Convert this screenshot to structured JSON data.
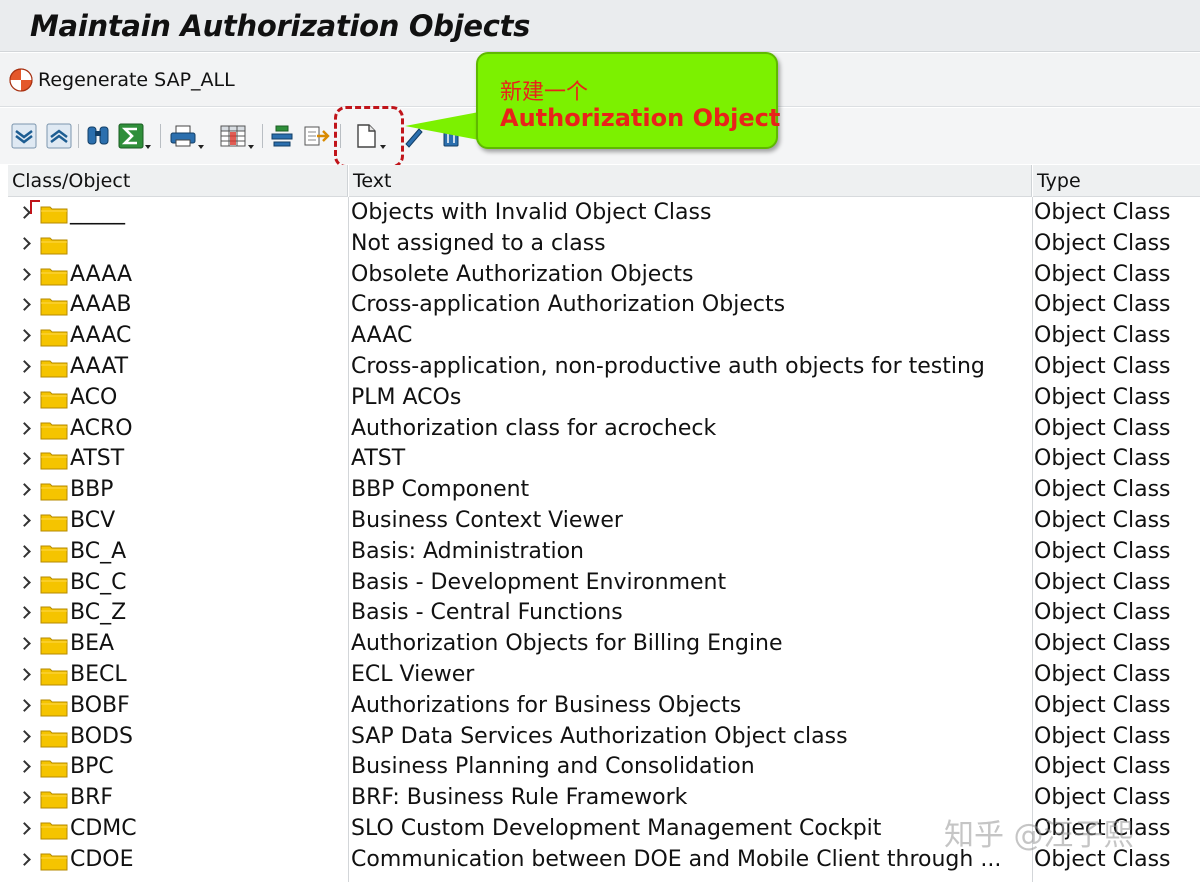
{
  "title": "Maintain Authorization Objects",
  "app_toolbar": {
    "regenerate_label": "Regenerate SAP_ALL",
    "regenerate_icon": "sap-regenerate-icon"
  },
  "toolbar": {
    "icons": [
      "expand-all-icon",
      "collapse-all-icon",
      "find-icon",
      "sum-icon",
      "print-icon",
      "layout-icon",
      "align-icon",
      "export-icon",
      "create-icon",
      "edit-icon",
      "delete-icon"
    ]
  },
  "callout": {
    "line1": "新建一个",
    "line2": "Authorization Object"
  },
  "columns": {
    "class_object": "Class/Object",
    "text": "Text",
    "type": "Type"
  },
  "rows": [
    {
      "cls": "_____",
      "text": "Objects with Invalid Object Class",
      "type": "Object Class"
    },
    {
      "cls": "",
      "text": "Not assigned to a class",
      "type": "Object Class"
    },
    {
      "cls": "AAAA",
      "text": "Obsolete Authorization Objects",
      "type": "Object Class"
    },
    {
      "cls": "AAAB",
      "text": "Cross-application Authorization Objects",
      "type": "Object Class"
    },
    {
      "cls": "AAAC",
      "text": "AAAC",
      "type": "Object Class"
    },
    {
      "cls": "AAAT",
      "text": "Cross-application, non-productive auth objects for testing",
      "type": "Object Class"
    },
    {
      "cls": "ACO",
      "text": "PLM ACOs",
      "type": "Object Class"
    },
    {
      "cls": "ACRO",
      "text": "Authorization class for acrocheck",
      "type": "Object Class"
    },
    {
      "cls": "ATST",
      "text": "ATST",
      "type": "Object Class"
    },
    {
      "cls": "BBP",
      "text": "BBP Component",
      "type": "Object Class"
    },
    {
      "cls": "BCV",
      "text": "Business Context Viewer",
      "type": "Object Class"
    },
    {
      "cls": "BC_A",
      "text": "Basis: Administration",
      "type": "Object Class"
    },
    {
      "cls": "BC_C",
      "text": "Basis - Development Environment",
      "type": "Object Class"
    },
    {
      "cls": "BC_Z",
      "text": "Basis - Central Functions",
      "type": "Object Class"
    },
    {
      "cls": "BEA",
      "text": "Authorization Objects for Billing Engine",
      "type": "Object Class"
    },
    {
      "cls": "BECL",
      "text": "ECL Viewer",
      "type": "Object Class"
    },
    {
      "cls": "BOBF",
      "text": "Authorizations for Business Objects",
      "type": "Object Class"
    },
    {
      "cls": "BODS",
      "text": "SAP Data Services Authorization Object class",
      "type": "Object Class"
    },
    {
      "cls": "BPC",
      "text": "Business Planning and Consolidation",
      "type": "Object Class"
    },
    {
      "cls": "BRF",
      "text": "BRF: Business Rule Framework",
      "type": "Object Class"
    },
    {
      "cls": "CDMC",
      "text": "SLO Custom Development Management Cockpit",
      "type": "Object Class"
    },
    {
      "cls": "CDOE",
      "text": "Communication between DOE and Mobile Client through ...",
      "type": "Object Class"
    }
  ],
  "watermark": "知乎 @汪子熙",
  "colors": {
    "callout_bg": "#7cf100",
    "callout_text": "#e8231a",
    "highlight": "#c0141a",
    "folder": "#f5c400"
  }
}
